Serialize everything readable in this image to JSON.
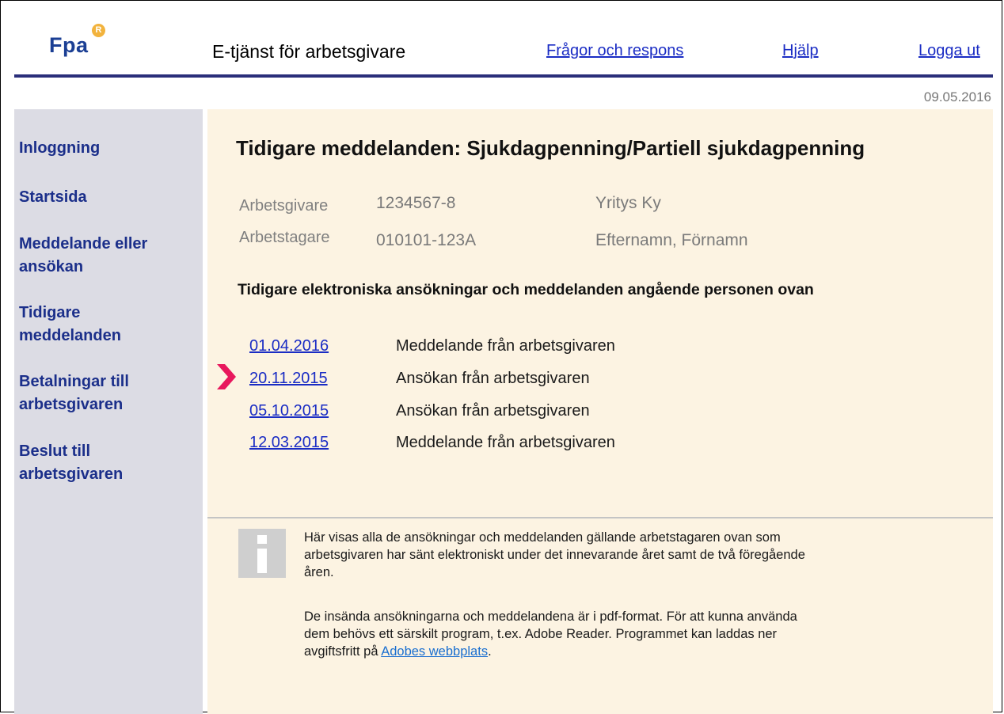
{
  "header": {
    "logo_text": "Fpa",
    "logo_mark": "R",
    "app_title": "E-tjänst för arbetsgivare",
    "links": {
      "feedback": "Frågor och respons",
      "help": "Hjälp",
      "logout": "Logga ut"
    }
  },
  "date": "09.05.2016",
  "sidebar": {
    "items": [
      {
        "line1": "Inloggning",
        "line2": ""
      },
      {
        "line1": "Startsida",
        "line2": ""
      },
      {
        "line1": "Meddelande eller",
        "line2": "ansökan"
      },
      {
        "line1": "Tidigare",
        "line2": "meddelanden"
      },
      {
        "line1": "Betalningar till",
        "line2": "arbetsgivaren"
      },
      {
        "line1": "Beslut till",
        "line2": "arbetsgivaren"
      }
    ]
  },
  "main": {
    "title": "Tidigare meddelanden: Sjukdagpenning/Partiell sjukdagpenning",
    "employer": {
      "label": "Arbetsgivare",
      "id": "1234567-8",
      "name": "Yritys Ky"
    },
    "employee": {
      "label": "Arbetstagare",
      "id": "010101-123A",
      "name": "Efternamn, Förnamn"
    },
    "section_title": "Tidigare elektroniska ansökningar och meddelanden angående personen ovan",
    "messages": [
      {
        "date": "01.04.2016",
        "type": "Meddelande från arbetsgivaren"
      },
      {
        "date": "20.11.2015",
        "type": "Ansökan från arbetsgivaren"
      },
      {
        "date": "05.10.2015",
        "type": "Ansökan från arbetsgivaren"
      },
      {
        "date": "12.03.2015",
        "type": "Meddelande från arbetsgivaren"
      }
    ],
    "info": {
      "icon": "info-icon",
      "p1_lines": [
        "Här visas alla de ansökningar och meddelanden gällande arbetstagaren ovan som",
        "arbetsgivaren har sänt elektroniskt under det innevarande året samt de två föregående",
        "åren."
      ],
      "p2_lines": [
        "De insända ansökningarna och meddelandena är i pdf-format. För att kunna använda",
        "dem behövs ett särskilt program, t.ex. Adobe Reader. Programmet kan laddas ner"
      ],
      "p2_last_prefix": "avgiftsfritt på ",
      "p2_link": "Adobes webbplats",
      "p2_suffix": "."
    }
  },
  "colors": {
    "brand_blue": "#1b3f94",
    "link_blue": "#1a2cc4",
    "marker_pink": "#e8175d",
    "main_bg": "#fcf3e2",
    "sidebar_bg": "#dcdce4"
  }
}
